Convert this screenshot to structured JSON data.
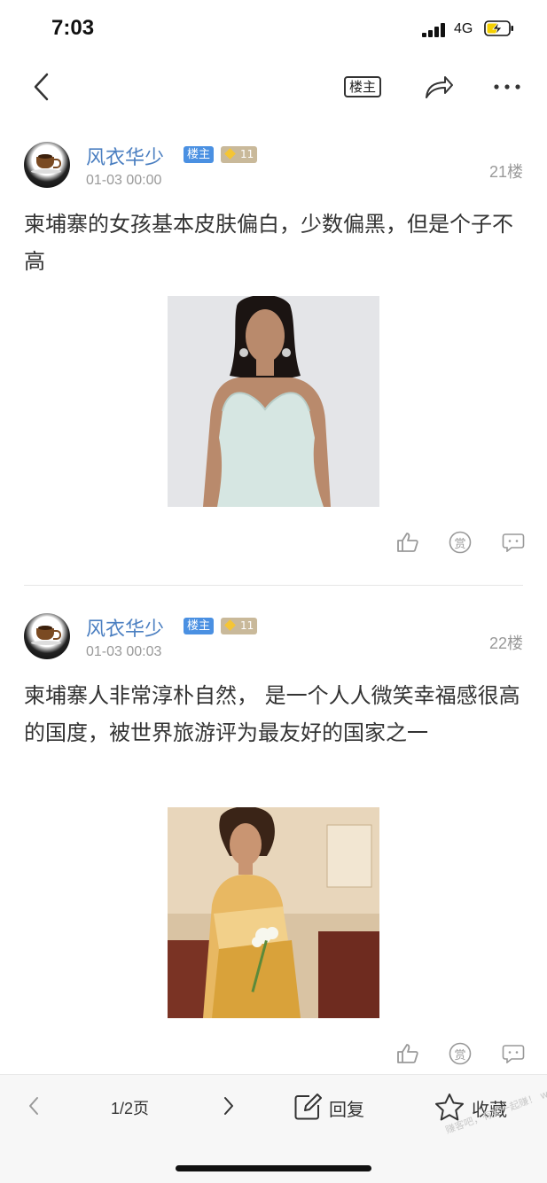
{
  "status_bar": {
    "time": "7:03",
    "network": "4G"
  },
  "nav": {
    "owner_button": "楼主"
  },
  "posts": [
    {
      "username": "风衣华少",
      "owner_badge": "楼主",
      "level": "11",
      "date": "01-03 00:00",
      "floor": "21楼",
      "text": "柬埔寨的女孩基本皮肤偏白，少数偏黑，但是个子不高",
      "reward_label": "赏"
    },
    {
      "username": "风衣华少",
      "owner_badge": "楼主",
      "level": "11",
      "date": "01-03 00:03",
      "floor": "22楼",
      "text": "柬埔寨人非常淳朴自然，  是一个人人微笑幸福感很高的国度，被世界旅游评为最友好的国家之一",
      "reward_label": "赏"
    }
  ],
  "bottom_bar": {
    "page_indicator": "1/2页",
    "reply_label": "回复",
    "favorite_label": "收藏"
  },
  "watermark": "赚客吧，有奖一起赚！ www.zuanke8.com",
  "colors": {
    "link_blue": "#4b7fc1",
    "owner_badge": "#4a90e2",
    "level_badge": "#c9b99a"
  }
}
